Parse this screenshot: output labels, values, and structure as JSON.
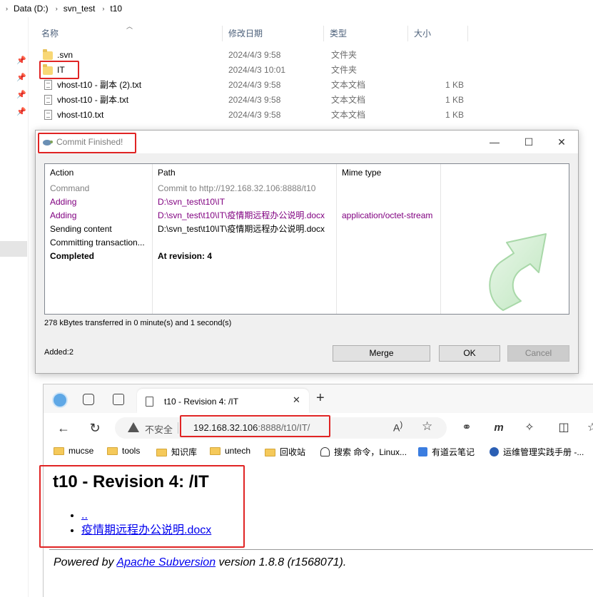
{
  "explorer": {
    "breadcrumb": [
      "Data (D:)",
      "svn_test",
      "t10"
    ],
    "columns": {
      "name": "名称",
      "modified": "修改日期",
      "type": "类型",
      "size": "大小"
    },
    "files": [
      {
        "name": ".svn",
        "modified": "2024/4/3 9:58",
        "type": "文件夹",
        "size": "",
        "icon": "folder-icon"
      },
      {
        "name": "IT",
        "modified": "2024/4/3 10:01",
        "type": "文件夹",
        "size": "",
        "icon": "folder-icon"
      },
      {
        "name": "vhost-t10 - 副本 (2).txt",
        "modified": "2024/4/3 9:58",
        "type": "文本文档",
        "size": "1 KB",
        "icon": "text-file-icon"
      },
      {
        "name": "vhost-t10 - 副本.txt",
        "modified": "2024/4/3 9:58",
        "type": "文本文档",
        "size": "1 KB",
        "icon": "text-file-icon"
      },
      {
        "name": "vhost-t10.txt",
        "modified": "2024/4/3 9:58",
        "type": "文本文档",
        "size": "1 KB",
        "icon": "text-file-icon"
      }
    ]
  },
  "dialog": {
    "title": "Commit Finished!",
    "columns": {
      "action": "Action",
      "path": "Path",
      "mime": "Mime type"
    },
    "rows": [
      {
        "action": "Command",
        "path": "Commit to http://192.168.32.106:8888/t10",
        "mime": "",
        "style": "gray"
      },
      {
        "action": "Adding",
        "path": "D:\\svn_test\\t10\\IT",
        "mime": "",
        "style": "purple"
      },
      {
        "action": "Adding",
        "path": "D:\\svn_test\\t10\\IT\\疫情期远程办公说明.docx",
        "mime": "application/octet-stream",
        "style": "purple"
      },
      {
        "action": "Sending content",
        "path": "D:\\svn_test\\t10\\IT\\疫情期远程办公说明.docx",
        "mime": "",
        "style": "normal"
      },
      {
        "action": "Committing transaction...",
        "path": "",
        "mime": "",
        "style": "normal"
      },
      {
        "action": "Completed",
        "path": "At revision: 4",
        "mime": "",
        "style": "bold"
      }
    ],
    "status": "278 kBytes transferred in 0 minute(s) and 1 second(s)",
    "summary": "Added:2",
    "buttons": {
      "merge": "Merge",
      "ok": "OK",
      "cancel": "Cancel"
    }
  },
  "browser": {
    "tab_title": "t10 - Revision 4: /IT",
    "security_label": "不安全",
    "url_host": "192.168.32.106",
    "url_path": ":8888/t10/IT/",
    "bookmarks": [
      "mucse",
      "tools",
      "知识库",
      "untech",
      "回收站",
      "搜索 命令，Linux...",
      "有道云笔记",
      "运维管理实践手册 -..."
    ],
    "page": {
      "heading": "t10 - Revision 4: /IT",
      "links": [
        "..",
        "疫情期远程办公说明.docx"
      ],
      "powered_prefix": "Powered by ",
      "powered_link": "Apache Subversion",
      "powered_suffix": " version 1.8.8 (r1568071)."
    }
  },
  "colors": {
    "highlight_box": "#e02424",
    "link": "#0000ee",
    "svn_purple": "#800080"
  }
}
